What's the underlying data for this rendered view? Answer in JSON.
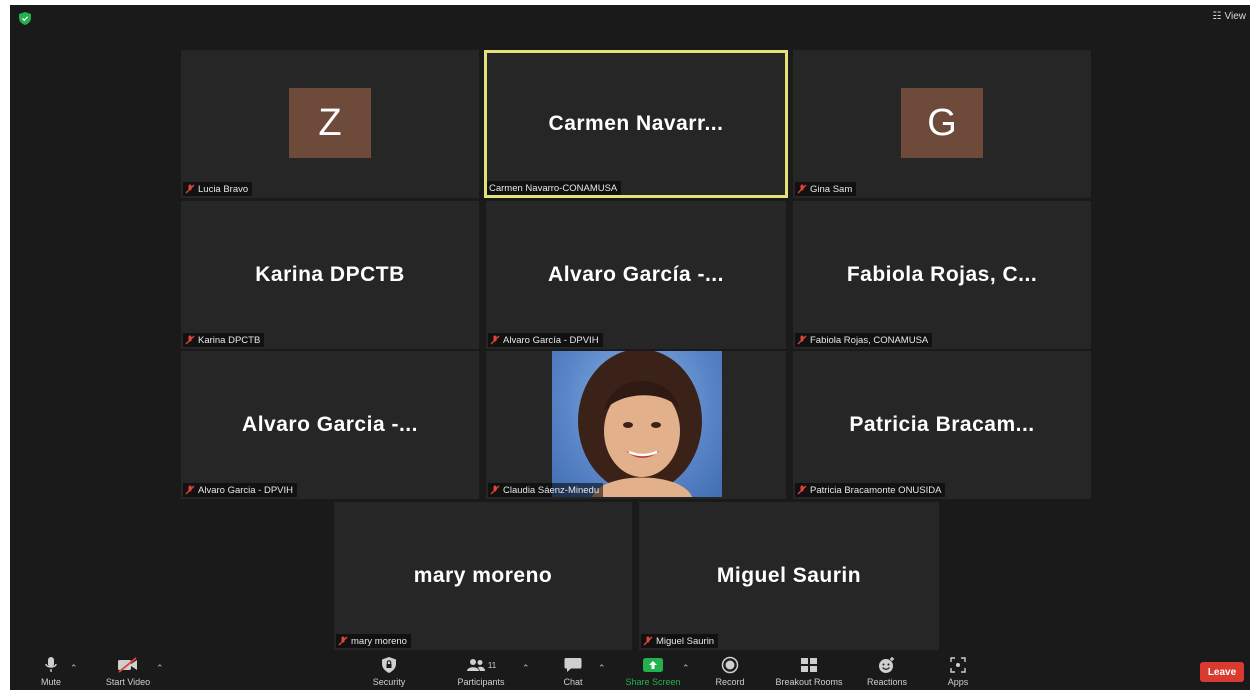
{
  "top_bar": {
    "view_label": "View"
  },
  "tiles": [
    {
      "display": "Z",
      "type": "avatar",
      "label": "Lucia Bravo",
      "muted": true
    },
    {
      "display": "Carmen  Navarr...",
      "type": "name",
      "label": "Carmen Navarro-CONAMUSA",
      "muted": false,
      "active": true
    },
    {
      "display": "G",
      "type": "avatar",
      "label": "Gina Sam",
      "muted": true
    },
    {
      "display": "Karina DPCTB",
      "type": "name",
      "label": "Karina DPCTB",
      "muted": true
    },
    {
      "display": "Alvaro García -...",
      "type": "name",
      "label": "Alvaro García - DPVIH",
      "muted": true
    },
    {
      "display": "Fabiola Rojas, C...",
      "type": "name",
      "label": "Fabiola Rojas, CONAMUSA",
      "muted": true
    },
    {
      "display": "Alvaro Garcia -...",
      "type": "name",
      "label": "Alvaro Garcia - DPVIH",
      "muted": true
    },
    {
      "display": "",
      "type": "photo",
      "label": "Claudia Sáenz-Minedu",
      "muted": true
    },
    {
      "display": "Patricia  Bracam...",
      "type": "name",
      "label": "Patricia Bracamonte ONUSIDA",
      "muted": true
    },
    {
      "display": "mary moreno",
      "type": "name",
      "label": "mary moreno",
      "muted": true
    },
    {
      "display": "Miguel Saurin",
      "type": "name",
      "label": "Miguel Saurin",
      "muted": true
    }
  ],
  "toolbar": {
    "mute_label": "Mute",
    "video_label": "Start Video",
    "security_label": "Security",
    "participants_label": "Participants",
    "participants_count": "11",
    "chat_label": "Chat",
    "share_label": "Share Screen",
    "record_label": "Record",
    "breakout_label": "Breakout Rooms",
    "reactions_label": "Reactions",
    "apps_label": "Apps",
    "leave_label": "Leave"
  },
  "colors": {
    "background": "#1a1a1a",
    "tile": "#262626",
    "active_border": "#e6e07a",
    "avatar": "#6e4a3a",
    "share_green": "#23b14d",
    "leave_red": "#d93b30",
    "mute_red": "#e0453a"
  }
}
